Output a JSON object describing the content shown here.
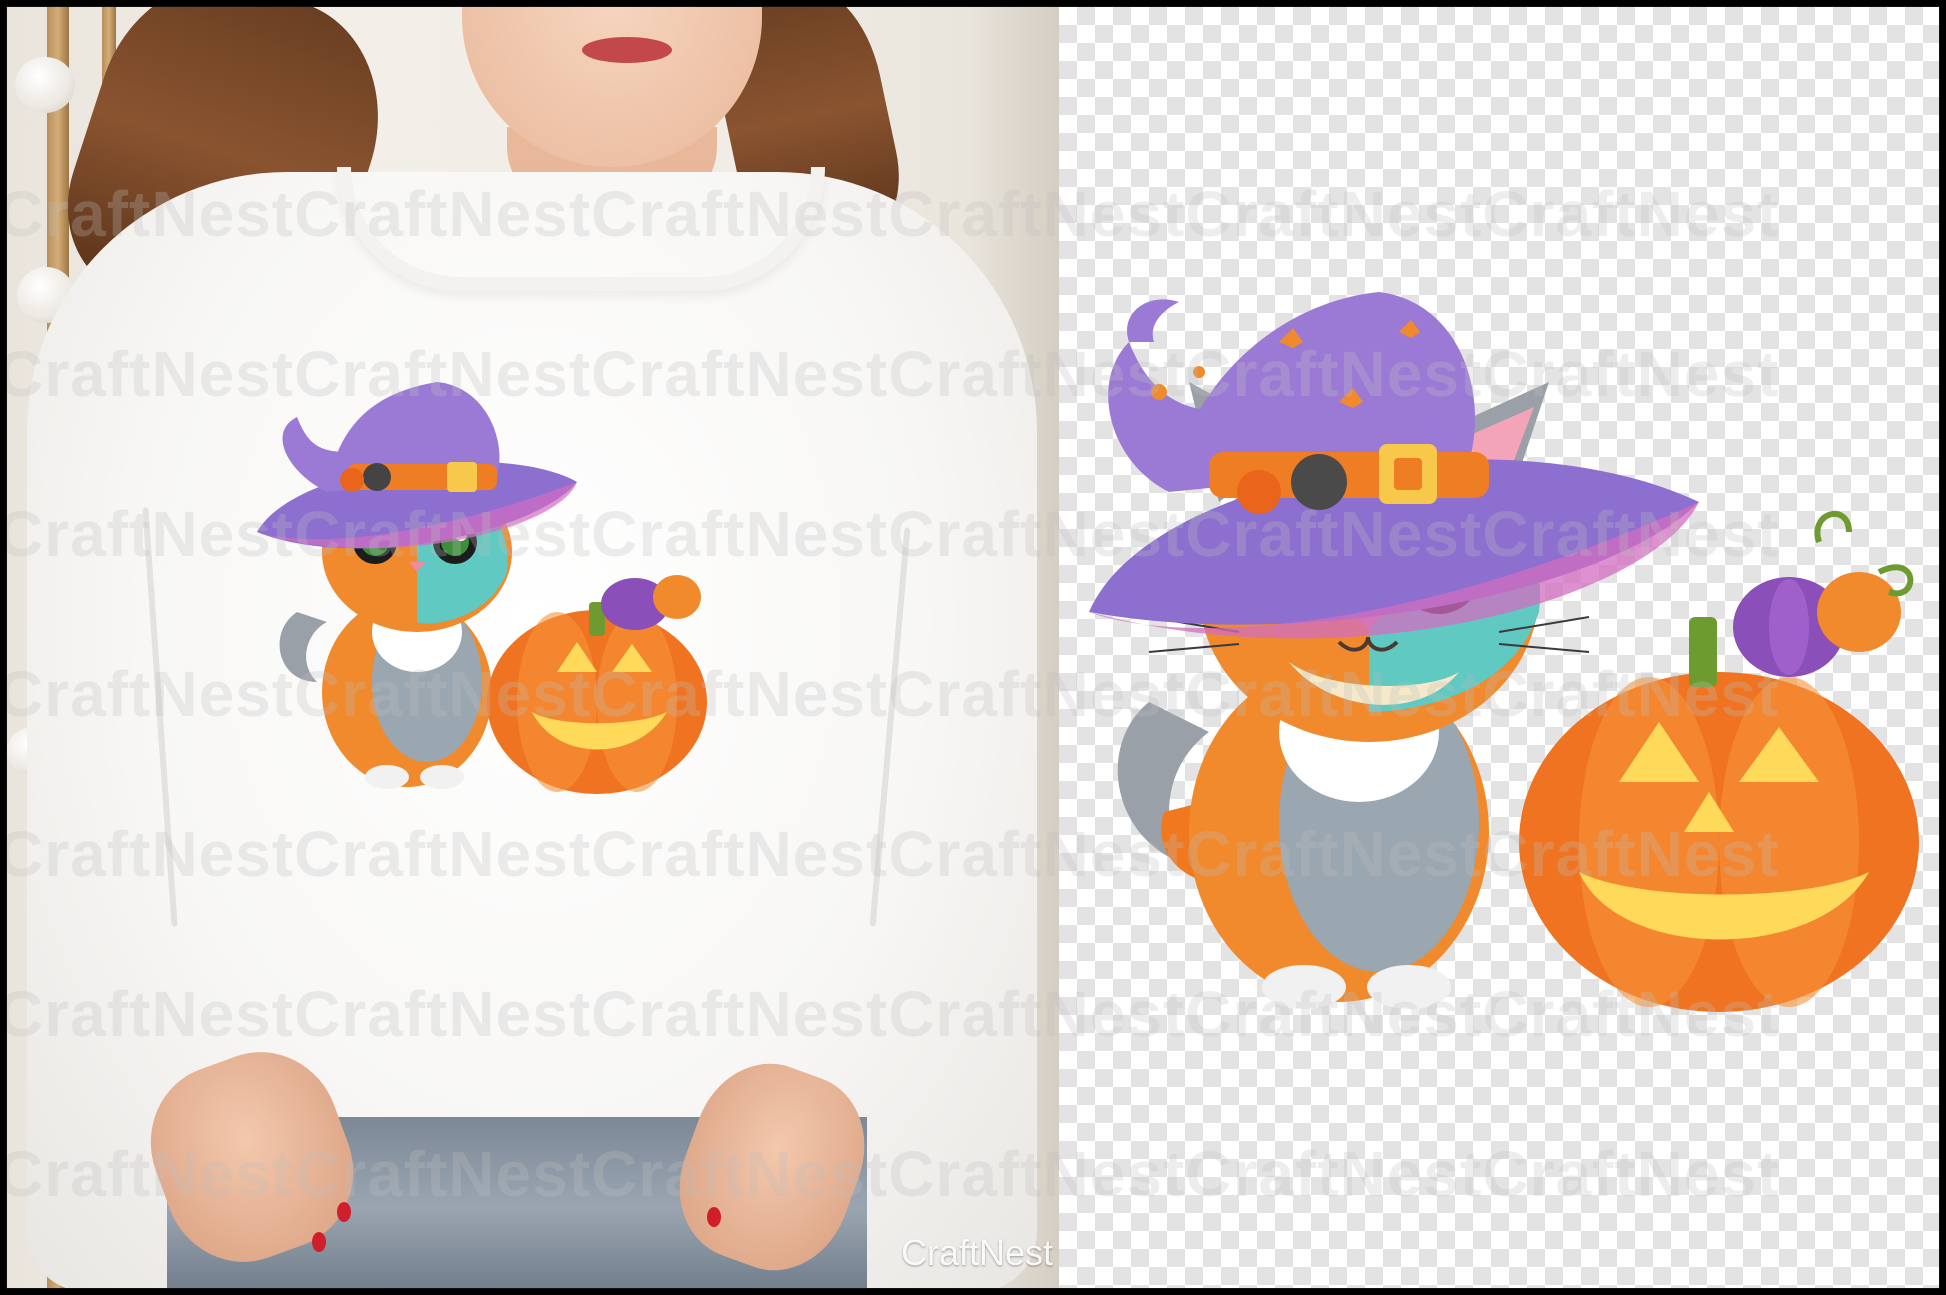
{
  "watermark": {
    "text": "CraftNestCraftNestCraftNestCraftNestCraftNestCraftNest"
  },
  "mockup": {
    "brand_label": "CraftNest"
  },
  "colors": {
    "hat_purple": "#9b7ad6",
    "pumpkin_orange": "#f07a1e",
    "nail_red": "#d01f2b"
  }
}
